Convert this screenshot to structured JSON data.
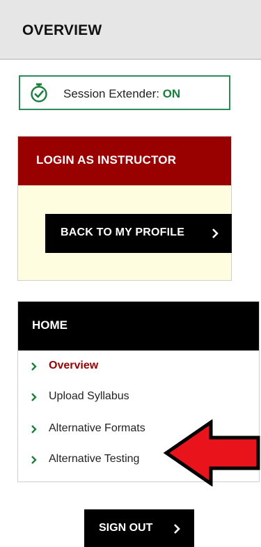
{
  "header": {
    "title": "OVERVIEW"
  },
  "session": {
    "label": "Session Extender:",
    "state": "ON",
    "icon": "stopwatch-check-icon",
    "icon_color": "#1a7f3c",
    "border_color": "#2e8b57"
  },
  "login": {
    "heading": "LOGIN AS INSTRUCTOR",
    "heading_bg": "#990000",
    "panel_bg": "#fffde0",
    "back_button": "BACK TO MY PROFILE"
  },
  "home": {
    "heading": "HOME",
    "items": [
      {
        "label": "Overview",
        "active": true
      },
      {
        "label": "Upload Syllabus",
        "active": false
      },
      {
        "label": "Alternative Formats",
        "active": false
      },
      {
        "label": "Alternative Testing",
        "active": false
      }
    ]
  },
  "annotation": {
    "icon": "red-arrow-left-icon",
    "color": "#e8131b"
  },
  "signout": {
    "label": "SIGN OUT"
  }
}
